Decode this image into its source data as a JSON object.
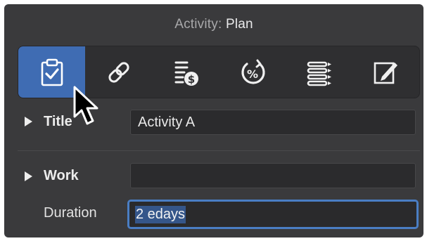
{
  "header": {
    "title_prefix": "Activity:",
    "title_name": "Plan"
  },
  "toolbar": {
    "selected_index": 0,
    "tools": [
      {
        "icon": "clipboard-check-icon",
        "selected": true
      },
      {
        "icon": "link-icon",
        "selected": false
      },
      {
        "icon": "cost-icon",
        "selected": false
      },
      {
        "icon": "percent-progress-icon",
        "selected": false
      },
      {
        "icon": "list-icon",
        "selected": false
      },
      {
        "icon": "edit-notes-icon",
        "selected": false
      }
    ]
  },
  "sections": {
    "title": {
      "label": "Title",
      "value": "Activity A"
    },
    "work": {
      "label": "Work",
      "value": "",
      "duration_label": "Duration",
      "duration_value": "2 edays"
    }
  },
  "colors": {
    "panel_bg": "#3a3a3c",
    "toolbar_bg": "#2f2f31",
    "accent": "#3f6cb3",
    "focus_ring": "#4a7ec4",
    "text_selection": "#35568a"
  }
}
